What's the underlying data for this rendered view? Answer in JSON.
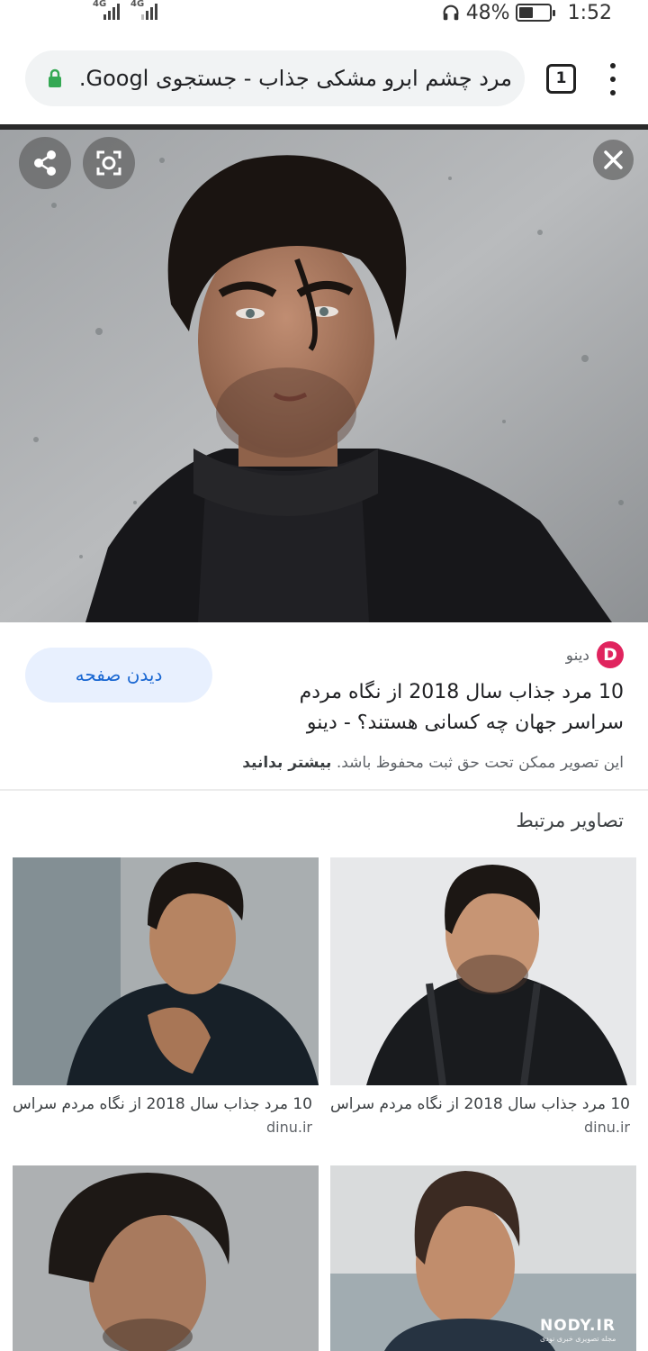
{
  "status_bar": {
    "network_1": "4G",
    "network_2": "4G",
    "battery_percent": "48%",
    "battery_level": 0.48,
    "time": "1:52",
    "icons": [
      "headphones-icon",
      "battery-icon",
      "signal-icon"
    ]
  },
  "browser": {
    "url_text": "مرد چشم ابرو مشکی جذاب - جستجوی Googl...",
    "tab_count": "1",
    "secure": true
  },
  "result": {
    "site_logo_letter": "D",
    "site_name": "دینو",
    "visit_label": "دیدن صفحه",
    "title": "10 مرد جذاب سال 2018 از نگاه مردم سراسر جهان چه کسانی هستند؟ - دینو",
    "copyright_text": "این تصویر ممکن تحت حق ثبت محفوظ باشد.",
    "learn_more": "بیشتر بدانید"
  },
  "related": {
    "heading": "تصاویر مرتبط",
    "items": [
      {
        "caption": "10 مرد جذاب سال 2018 از نگاه مردم سراس ...",
        "domain": "dinu.ir"
      },
      {
        "caption": "10 مرد جذاب سال 2018 از نگاه مردم سراس ...",
        "domain": "dinu.ir"
      },
      {
        "caption": "",
        "domain": ""
      },
      {
        "caption": "",
        "domain": ""
      }
    ]
  },
  "watermark": {
    "line1": "NODY.IR",
    "line2": "مجله تصویری خبری نودی"
  },
  "colors": {
    "accent": "#1967d2",
    "pill_bg": "#f1f3f4",
    "button_bg": "#e8f0fe",
    "logo": "#e0245e",
    "lock": "#34a853"
  }
}
